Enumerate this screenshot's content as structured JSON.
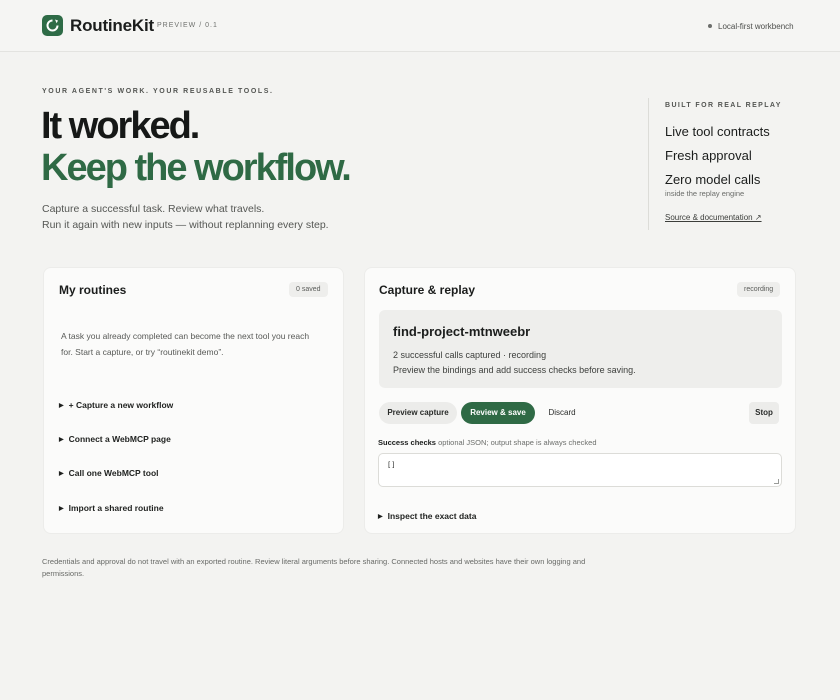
{
  "header": {
    "brand": "RoutineKit",
    "tag": "PREVIEW / 0.1",
    "status": "Local-first workbench"
  },
  "hero": {
    "eyebrow": "YOUR AGENT'S WORK. YOUR REUSABLE TOOLS.",
    "headline_1": "It worked.",
    "headline_2": "Keep the workflow.",
    "intro_1": "Capture a successful task. Review what travels.",
    "intro_2": "Run it again with new inputs — without replanning every step."
  },
  "aside": {
    "eyebrow": "BUILT FOR REAL REPLAY",
    "item_1": "Live tool contracts",
    "item_2": "Fresh approval",
    "item_3": "Zero model calls",
    "item_3_sub": "inside the replay engine",
    "link": "Source & documentation ↗"
  },
  "routines": {
    "title": "My routines",
    "count": "0 saved",
    "empty_1": "A task you already completed can become the next tool you reach",
    "empty_2": "for. Start a capture, or try “routinekit demo”.",
    "actions": [
      "+ Capture a new workflow",
      "Connect a WebMCP page",
      "Call one WebMCP tool",
      "Import a shared routine"
    ]
  },
  "capture": {
    "title": "Capture & replay",
    "state": "recording",
    "routine_name": "find-project-mtnweebr",
    "summary": "2 successful calls captured · recording",
    "hint": "Preview the bindings and add success checks before saving.",
    "buttons": {
      "preview": "Preview capture",
      "review": "Review & save",
      "discard": "Discard",
      "stop": "Stop"
    },
    "checks_label": "Success checks",
    "checks_hint": "optional JSON; output shape is always checked",
    "checks_value": "[]",
    "inspect": "Inspect the exact data"
  },
  "footer": {
    "note": "Credentials and approval do not travel with an exported routine. Review literal arguments before sharing. Connected hosts and websites have their own logging and permissions."
  }
}
